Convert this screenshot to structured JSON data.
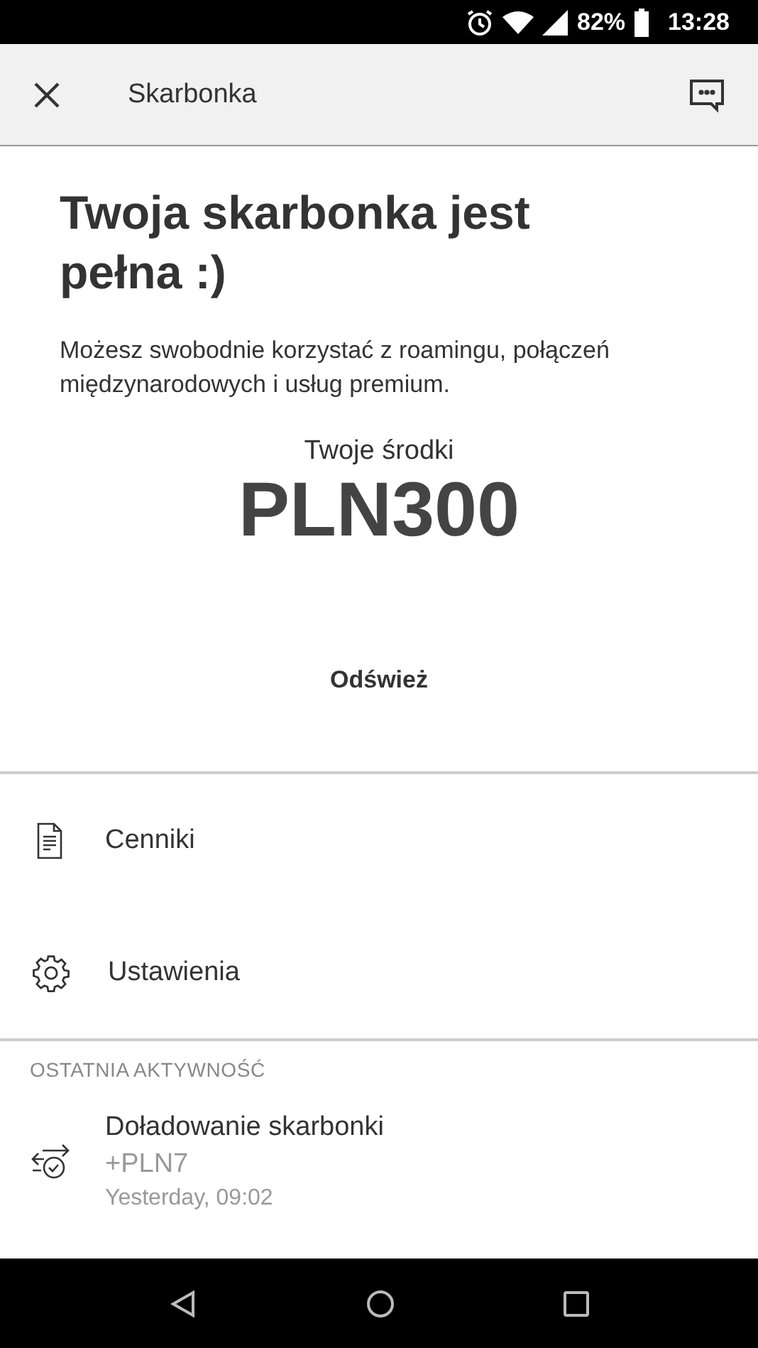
{
  "status_bar": {
    "battery": "82%",
    "time": "13:28"
  },
  "app_bar": {
    "title": "Skarbonka"
  },
  "heading": "Twoja skarbonka jest pełna :)",
  "description": "Możesz swobodnie korzystać z roamingu, połączeń międzynarodowych i usług premium.",
  "balance": {
    "label": "Twoje środki",
    "amount": "PLN300"
  },
  "refresh": "Odśwież",
  "menu": [
    {
      "kind": "document",
      "label": "Cenniki"
    },
    {
      "kind": "settings",
      "label": "Ustawienia"
    }
  ],
  "activity": {
    "header": "OSTATNIA AKTYWNOŚĆ",
    "items": [
      {
        "title": "Doładowanie skarbonki",
        "amount": "+PLN7",
        "time": "Yesterday, 09:02"
      }
    ]
  }
}
